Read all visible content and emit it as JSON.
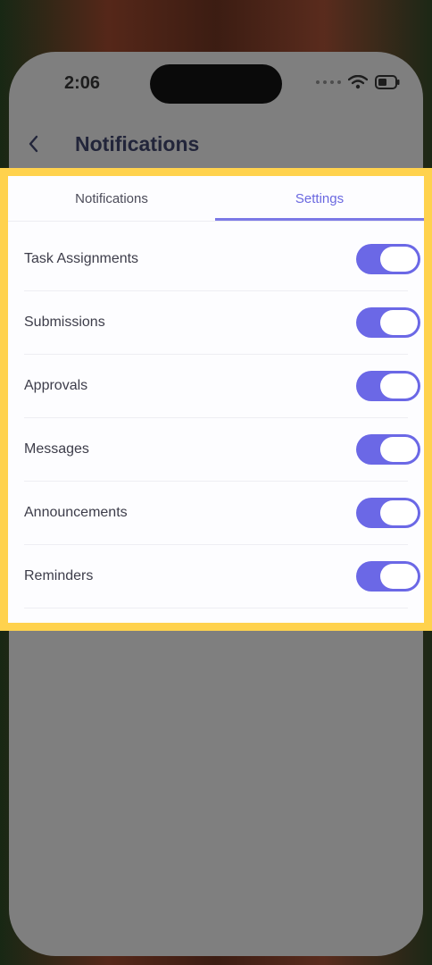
{
  "status_bar": {
    "time": "2:06"
  },
  "header": {
    "title": "Notifications"
  },
  "tabs": [
    {
      "label": "Notifications",
      "active": false
    },
    {
      "label": "Settings",
      "active": true
    }
  ],
  "settings": [
    {
      "label": "Task Assignments",
      "enabled": true
    },
    {
      "label": "Submissions",
      "enabled": true
    },
    {
      "label": "Approvals",
      "enabled": true
    },
    {
      "label": "Messages",
      "enabled": true
    },
    {
      "label": "Announcements",
      "enabled": true
    },
    {
      "label": "Reminders",
      "enabled": true
    }
  ],
  "colors": {
    "accent": "#6b68e6",
    "highlight": "#ffd24d",
    "overlay": "#7f7f7f"
  }
}
